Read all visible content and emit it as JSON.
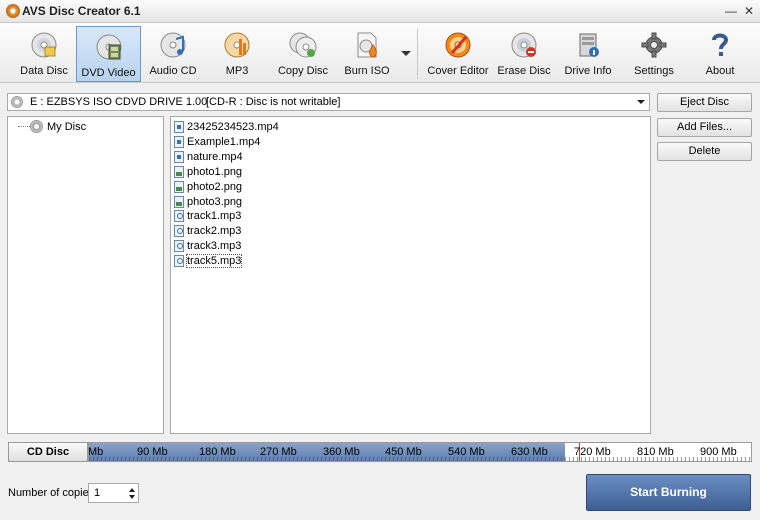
{
  "window": {
    "title": "AVS Disc Creator 6.1",
    "icons": {
      "app": "disc-flame-icon",
      "minimize": "minimize-icon",
      "close": "close-icon"
    }
  },
  "toolbar": {
    "items": [
      {
        "label": "Data Disc",
        "icon": "data-disc-icon",
        "active": false
      },
      {
        "label": "DVD Video",
        "icon": "dvd-video-icon",
        "active": true
      },
      {
        "label": "Audio CD",
        "icon": "audio-cd-icon",
        "active": false
      },
      {
        "label": "MP3",
        "icon": "mp3-disc-icon",
        "active": false
      },
      {
        "label": "Copy Disc",
        "icon": "copy-disc-icon",
        "active": false
      },
      {
        "label": "Burn ISO",
        "icon": "burn-iso-icon",
        "active": false
      },
      {
        "label": "Cover Editor",
        "icon": "cover-editor-icon",
        "active": false
      },
      {
        "label": "Erase Disc",
        "icon": "erase-disc-icon",
        "active": false
      },
      {
        "label": "Drive Info",
        "icon": "drive-info-icon",
        "active": false
      },
      {
        "label": "Settings",
        "icon": "gear-icon",
        "active": false
      },
      {
        "label": "About",
        "icon": "question-icon",
        "active": false
      }
    ]
  },
  "drive": {
    "selected": "E : EZBSYS   ISO CDVD DRIVE    1.00",
    "status": "[CD-R : Disc is not writable]"
  },
  "side_buttons": {
    "eject": "Eject Disc",
    "add_files": "Add Files...",
    "delete": "Delete"
  },
  "tree": {
    "root": "My Disc"
  },
  "files": [
    {
      "name": "23425234523.mp4",
      "type": "video"
    },
    {
      "name": "Example1.mp4",
      "type": "video"
    },
    {
      "name": "nature.mp4",
      "type": "video"
    },
    {
      "name": "photo1.png",
      "type": "image"
    },
    {
      "name": "photo2.png",
      "type": "image"
    },
    {
      "name": "photo3.png",
      "type": "image"
    },
    {
      "name": "track1.mp3",
      "type": "audio"
    },
    {
      "name": "track2.mp3",
      "type": "audio"
    },
    {
      "name": "track3.mp3",
      "type": "audio"
    },
    {
      "name": "track5.mp3",
      "type": "audio",
      "selected": true
    }
  ],
  "capacity": {
    "disc_type": "CD Disc",
    "used_mb": 680,
    "limit_mb": 700,
    "max_mb": 945,
    "ticks": [
      "Mb",
      "90 Mb",
      "180 Mb",
      "270 Mb",
      "360 Mb",
      "450 Mb",
      "540 Mb",
      "630 Mb",
      "720 Mb",
      "810 Mb",
      "900 Mb"
    ],
    "colors": {
      "fill": "#5d7eae",
      "limit_marker": "#d83a1a"
    }
  },
  "copies": {
    "label": "Number of copies:",
    "value": "1"
  },
  "start_button": {
    "label": "Start Burning",
    "color": "#3e5f93"
  }
}
